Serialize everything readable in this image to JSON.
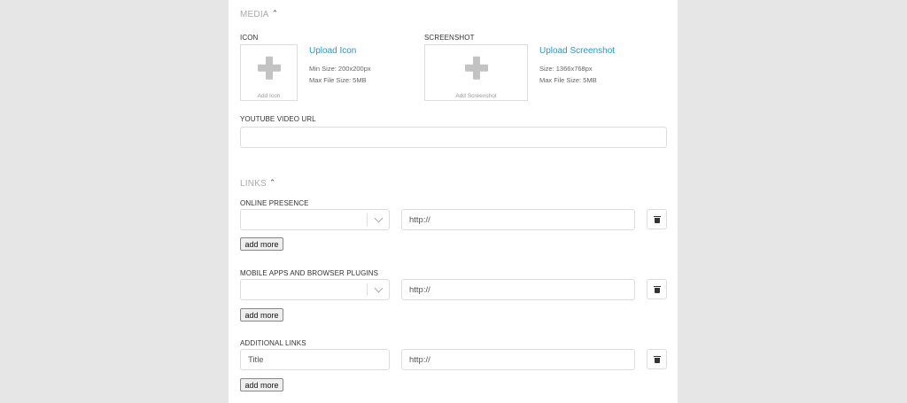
{
  "media": {
    "title": "MEDIA",
    "icon": {
      "label": "ICON",
      "box_caption": "Add Icon",
      "upload_link": "Upload Icon",
      "min_size": "Min Size: 200x200px",
      "max_file": "Max File Size: 5MB"
    },
    "screenshot": {
      "label": "SCREENSHOT",
      "box_caption": "Add Screenshot",
      "upload_link": "Upload Screenshot",
      "size": "Size: 1366x768px",
      "max_file": "Max File Size: 5MB"
    },
    "youtube": {
      "label": "YOUTUBE VIDEO URL",
      "value": ""
    }
  },
  "links": {
    "title": "LINKS",
    "online_presence": {
      "label": "ONLINE PRESENCE",
      "select_value": "",
      "url_placeholder": "http://",
      "add_more": "add more"
    },
    "mobile_apps": {
      "label": "MOBILE APPS AND BROWSER PLUGINS",
      "select_value": "",
      "url_placeholder": "http://",
      "add_more": "add more"
    },
    "additional": {
      "label": "ADDITIONAL LINKS",
      "title_placeholder": "Title",
      "url_placeholder": "http://",
      "add_more": "add more"
    }
  },
  "colors": {
    "link": "#1a9ad6",
    "background": "#e6e6e6",
    "panel": "#ffffff"
  }
}
